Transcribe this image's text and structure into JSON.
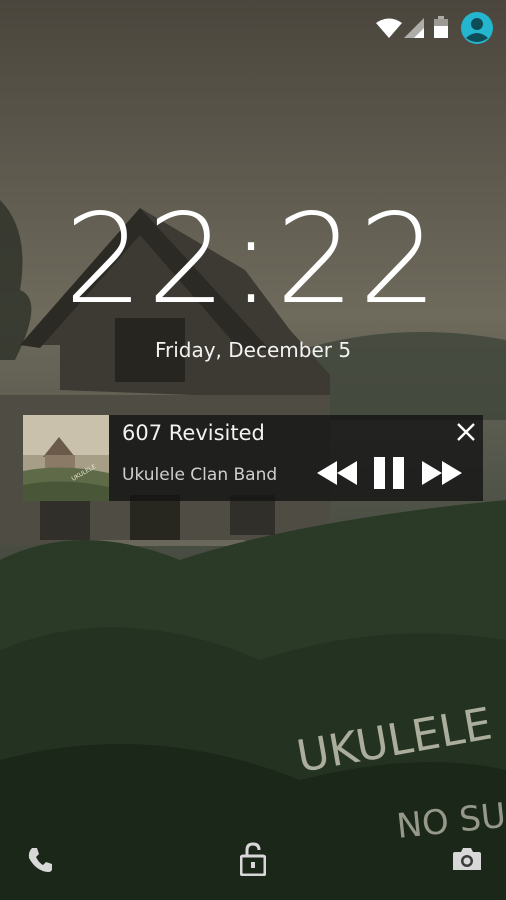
{
  "status_bar": {
    "icons": [
      "wifi-icon",
      "signal-icon",
      "battery-icon",
      "user-avatar-icon"
    ],
    "accent": "#24b6cf"
  },
  "lockscreen": {
    "time": "22:22",
    "date": "Friday, December 5"
  },
  "media": {
    "title": "607 Revisited",
    "artist": "Ukulele Clan Band",
    "controls": [
      "rewind-icon",
      "pause-icon",
      "fast-forward-icon",
      "close-icon"
    ]
  },
  "wallpaper_text": [
    "UKULELE CL",
    "NO SUG"
  ],
  "bottom_bar": {
    "icons": [
      "phone-icon",
      "unlock-icon",
      "camera-icon"
    ]
  }
}
